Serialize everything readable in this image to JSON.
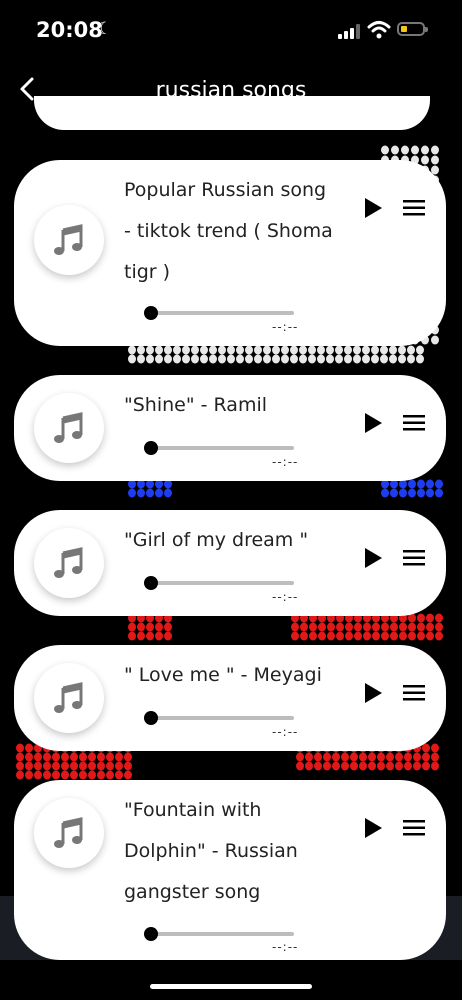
{
  "status": {
    "time": "20:08"
  },
  "header": {
    "title": "russian songs"
  },
  "songs": [
    {
      "title": "Popular Russian song - tiktok trend ( Shoma tigr )",
      "duration": "--:--"
    },
    {
      "title": "\"Shine\" - Ramil",
      "duration": "--:--"
    },
    {
      "title": "\"Girl of my dream \"",
      "duration": "--:--"
    },
    {
      "title": "\" Love me \"  - Meyagi",
      "duration": "--:--"
    },
    {
      "title": "\"Fountain with Dolphin\" - Russian gangster song",
      "duration": "--:--"
    }
  ],
  "icons": {
    "back": "chevron-left-icon",
    "art": "music-note-icon",
    "play": "play-icon",
    "menu": "hamburger-menu-icon"
  },
  "colors": {
    "background": "#000000",
    "card": "#ffffff",
    "flag_white": "#e8e8e8",
    "flag_blue": "#1f3df0",
    "flag_red": "#e01818",
    "battery": "#f5c518"
  }
}
